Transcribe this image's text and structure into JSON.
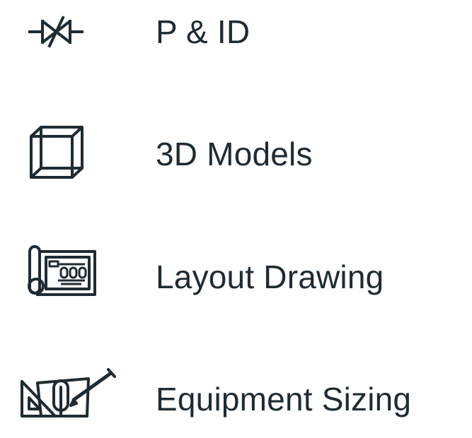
{
  "menu": {
    "items": [
      {
        "label": "P & ID",
        "icon": "valve-icon"
      },
      {
        "label": "3D Models",
        "icon": "cube-icon"
      },
      {
        "label": "Layout Drawing",
        "icon": "blueprint-icon"
      },
      {
        "label": "Equipment Sizing",
        "icon": "drafting-tools-icon"
      }
    ]
  },
  "colors": {
    "icon_stroke": "#1f2b33",
    "text": "#1f2b33",
    "background": "#ffffff"
  }
}
